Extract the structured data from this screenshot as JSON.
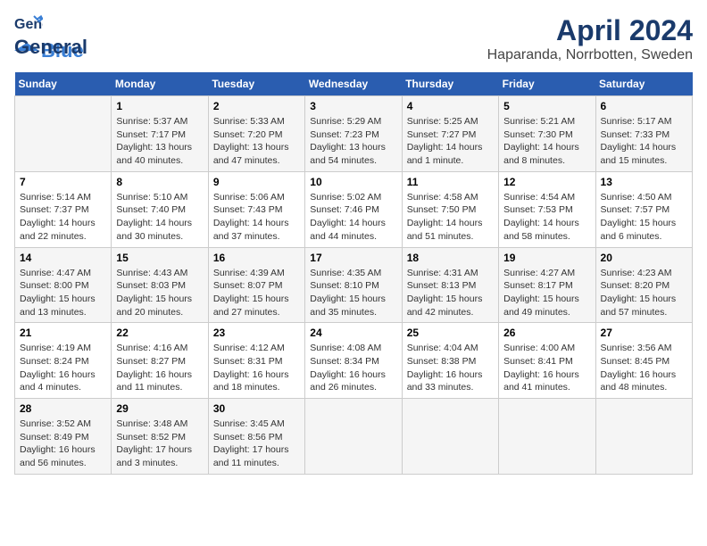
{
  "logo": {
    "line1": "General",
    "line2": "Blue"
  },
  "title": "April 2024",
  "subtitle": "Haparanda, Norrbotten, Sweden",
  "days_header": [
    "Sunday",
    "Monday",
    "Tuesday",
    "Wednesday",
    "Thursday",
    "Friday",
    "Saturday"
  ],
  "weeks": [
    [
      {
        "day": "",
        "info": ""
      },
      {
        "day": "1",
        "info": "Sunrise: 5:37 AM\nSunset: 7:17 PM\nDaylight: 13 hours\nand 40 minutes."
      },
      {
        "day": "2",
        "info": "Sunrise: 5:33 AM\nSunset: 7:20 PM\nDaylight: 13 hours\nand 47 minutes."
      },
      {
        "day": "3",
        "info": "Sunrise: 5:29 AM\nSunset: 7:23 PM\nDaylight: 13 hours\nand 54 minutes."
      },
      {
        "day": "4",
        "info": "Sunrise: 5:25 AM\nSunset: 7:27 PM\nDaylight: 14 hours\nand 1 minute."
      },
      {
        "day": "5",
        "info": "Sunrise: 5:21 AM\nSunset: 7:30 PM\nDaylight: 14 hours\nand 8 minutes."
      },
      {
        "day": "6",
        "info": "Sunrise: 5:17 AM\nSunset: 7:33 PM\nDaylight: 14 hours\nand 15 minutes."
      }
    ],
    [
      {
        "day": "7",
        "info": "Sunrise: 5:14 AM\nSunset: 7:37 PM\nDaylight: 14 hours\nand 22 minutes."
      },
      {
        "day": "8",
        "info": "Sunrise: 5:10 AM\nSunset: 7:40 PM\nDaylight: 14 hours\nand 30 minutes."
      },
      {
        "day": "9",
        "info": "Sunrise: 5:06 AM\nSunset: 7:43 PM\nDaylight: 14 hours\nand 37 minutes."
      },
      {
        "day": "10",
        "info": "Sunrise: 5:02 AM\nSunset: 7:46 PM\nDaylight: 14 hours\nand 44 minutes."
      },
      {
        "day": "11",
        "info": "Sunrise: 4:58 AM\nSunset: 7:50 PM\nDaylight: 14 hours\nand 51 minutes."
      },
      {
        "day": "12",
        "info": "Sunrise: 4:54 AM\nSunset: 7:53 PM\nDaylight: 14 hours\nand 58 minutes."
      },
      {
        "day": "13",
        "info": "Sunrise: 4:50 AM\nSunset: 7:57 PM\nDaylight: 15 hours\nand 6 minutes."
      }
    ],
    [
      {
        "day": "14",
        "info": "Sunrise: 4:47 AM\nSunset: 8:00 PM\nDaylight: 15 hours\nand 13 minutes."
      },
      {
        "day": "15",
        "info": "Sunrise: 4:43 AM\nSunset: 8:03 PM\nDaylight: 15 hours\nand 20 minutes."
      },
      {
        "day": "16",
        "info": "Sunrise: 4:39 AM\nSunset: 8:07 PM\nDaylight: 15 hours\nand 27 minutes."
      },
      {
        "day": "17",
        "info": "Sunrise: 4:35 AM\nSunset: 8:10 PM\nDaylight: 15 hours\nand 35 minutes."
      },
      {
        "day": "18",
        "info": "Sunrise: 4:31 AM\nSunset: 8:13 PM\nDaylight: 15 hours\nand 42 minutes."
      },
      {
        "day": "19",
        "info": "Sunrise: 4:27 AM\nSunset: 8:17 PM\nDaylight: 15 hours\nand 49 minutes."
      },
      {
        "day": "20",
        "info": "Sunrise: 4:23 AM\nSunset: 8:20 PM\nDaylight: 15 hours\nand 57 minutes."
      }
    ],
    [
      {
        "day": "21",
        "info": "Sunrise: 4:19 AM\nSunset: 8:24 PM\nDaylight: 16 hours\nand 4 minutes."
      },
      {
        "day": "22",
        "info": "Sunrise: 4:16 AM\nSunset: 8:27 PM\nDaylight: 16 hours\nand 11 minutes."
      },
      {
        "day": "23",
        "info": "Sunrise: 4:12 AM\nSunset: 8:31 PM\nDaylight: 16 hours\nand 18 minutes."
      },
      {
        "day": "24",
        "info": "Sunrise: 4:08 AM\nSunset: 8:34 PM\nDaylight: 16 hours\nand 26 minutes."
      },
      {
        "day": "25",
        "info": "Sunrise: 4:04 AM\nSunset: 8:38 PM\nDaylight: 16 hours\nand 33 minutes."
      },
      {
        "day": "26",
        "info": "Sunrise: 4:00 AM\nSunset: 8:41 PM\nDaylight: 16 hours\nand 41 minutes."
      },
      {
        "day": "27",
        "info": "Sunrise: 3:56 AM\nSunset: 8:45 PM\nDaylight: 16 hours\nand 48 minutes."
      }
    ],
    [
      {
        "day": "28",
        "info": "Sunrise: 3:52 AM\nSunset: 8:49 PM\nDaylight: 16 hours\nand 56 minutes."
      },
      {
        "day": "29",
        "info": "Sunrise: 3:48 AM\nSunset: 8:52 PM\nDaylight: 17 hours\nand 3 minutes."
      },
      {
        "day": "30",
        "info": "Sunrise: 3:45 AM\nSunset: 8:56 PM\nDaylight: 17 hours\nand 11 minutes."
      },
      {
        "day": "",
        "info": ""
      },
      {
        "day": "",
        "info": ""
      },
      {
        "day": "",
        "info": ""
      },
      {
        "day": "",
        "info": ""
      }
    ]
  ]
}
